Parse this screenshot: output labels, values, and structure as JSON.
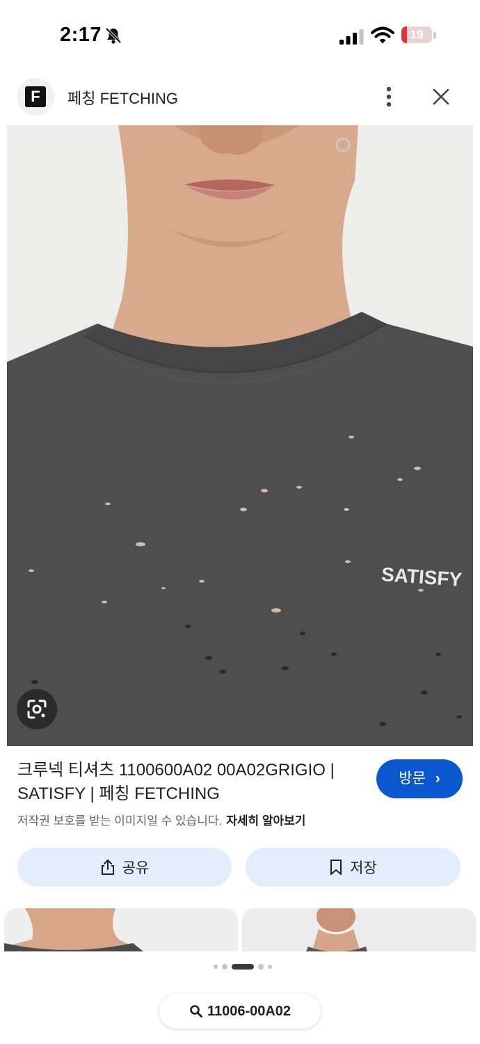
{
  "status_bar": {
    "time": "2:17",
    "battery_level": "19",
    "battery_fraction": 0.19,
    "signal_bars_active": 3,
    "signal_bars_total": 4,
    "colors": {
      "battery_low": "#e0353b"
    }
  },
  "header": {
    "site_logo_letter": "F",
    "site_name": "페칭 FETCHING",
    "icons": {
      "more": "more-vert-icon",
      "close": "close-icon"
    }
  },
  "image": {
    "print_text": "SATISFY",
    "icons": {
      "lens": "lens-icon"
    }
  },
  "result": {
    "title": "크루넥 티셔츠 1100600A02 00A02GRIGIO | SATISFY | 페칭 FETCHING",
    "visit_label": "방문",
    "copyright_notice": "저작권 보호를 받는 이미지일 수 있습니다.",
    "learn_more": "자세히 알아보기",
    "colors": {
      "accent": "#0b57d0",
      "action_bg": "#e3edfb"
    }
  },
  "actions": {
    "share_label": "공유",
    "save_label": "저장",
    "icons": {
      "share": "share-icon",
      "save": "bookmark-icon"
    }
  },
  "pagination": {
    "total": 5,
    "active_index": 2
  },
  "search_chip": {
    "query": "11006-00A02",
    "icon": "search-icon"
  }
}
